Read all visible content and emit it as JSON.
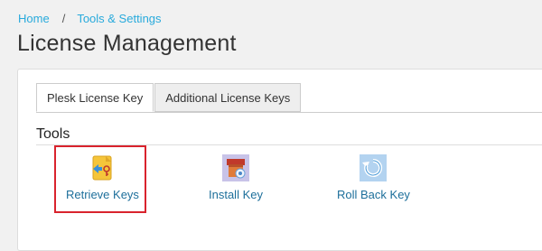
{
  "breadcrumb": {
    "home": "Home",
    "separator": "/",
    "current": "Tools & Settings"
  },
  "page": {
    "title": "License Management"
  },
  "tabs": [
    {
      "label": "Plesk License Key",
      "active": true
    },
    {
      "label": "Additional License Keys",
      "active": false
    }
  ],
  "section": {
    "title": "Tools"
  },
  "tools": [
    {
      "label": "Retrieve Keys",
      "icon": "retrieve-keys-icon",
      "highlighted": true
    },
    {
      "label": "Install Key",
      "icon": "install-key-icon",
      "highlighted": false
    },
    {
      "label": "Roll Back Key",
      "icon": "roll-back-key-icon",
      "highlighted": false
    }
  ],
  "colors": {
    "link": "#28aadc",
    "tool_label": "#1d6f9b",
    "highlight": "#d9232d"
  }
}
